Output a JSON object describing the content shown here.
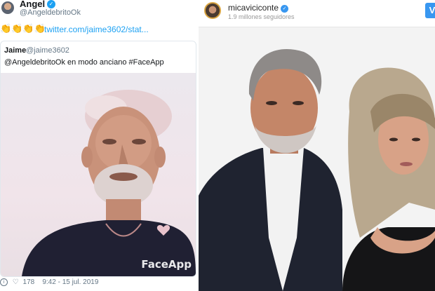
{
  "tweet": {
    "author_name": "Angel",
    "author_handle": "@AngeldebritoOk",
    "emojis": "👏👏👏👏",
    "link_text": "twitter.com/jaime3602/stat...",
    "quote": {
      "name": "Jaime",
      "handle": "@jaime3602",
      "text": "@AngeldebritoOk en modo anciano  #FaceApp",
      "watermark": "FaceApp"
    },
    "likes": "178",
    "timestamp": "9:42 - 15 jul. 2019"
  },
  "instagram": {
    "username": "micaviciconte",
    "followers": "1.9 millones seguidores",
    "follow_label": "V"
  },
  "colors": {
    "twitter_blue": "#1da1f2",
    "instagram_blue": "#3897f0"
  }
}
